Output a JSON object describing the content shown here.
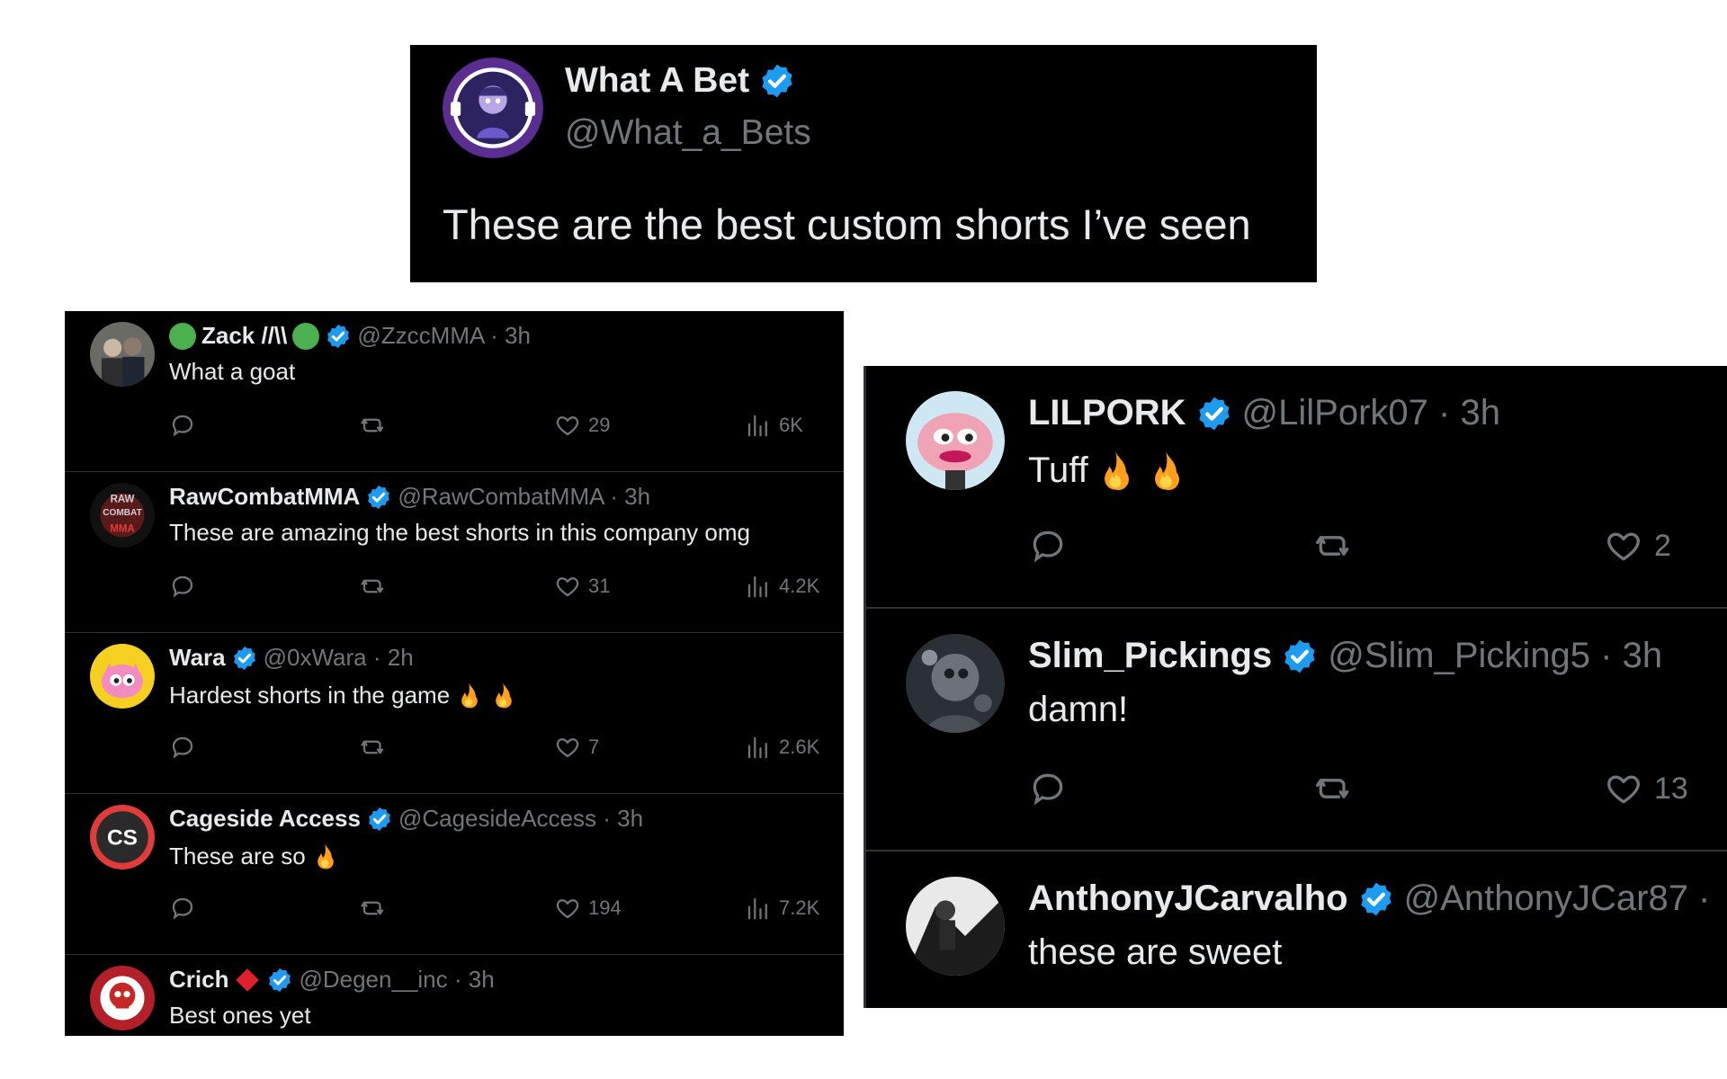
{
  "colors": {
    "verified": "#1d9bf0",
    "text": "#e7e9ea",
    "muted": "#71767b",
    "divider": "#2f3336",
    "background": "#000000"
  },
  "top_tweet": {
    "name": "What A Bet",
    "handle": "@What_a_Bets",
    "text": "These are the best custom shorts I’ve seen",
    "avatar_icon": "what-a-bet-avatar"
  },
  "left_replies": [
    {
      "name": "Zack //\\\\",
      "meta": "@ZzccMMA · 3h",
      "text": "What a goat",
      "likes": "29",
      "views": "6K"
    },
    {
      "name": "RawCombatMMA",
      "meta": "@RawCombatMMA · 3h",
      "text": "These are amazing the best shorts in this company omg",
      "likes": "31",
      "views": "4.2K",
      "avatar_text": "RAW COMBAT MMA"
    },
    {
      "name": "Wara",
      "meta": "@0xWara · 2h",
      "text": "Hardest shorts in the game",
      "likes": "7",
      "views": "2.6K"
    },
    {
      "name": "Cageside Access",
      "meta": "@CagesideAccess · 3h",
      "text": "These are so",
      "likes": "194",
      "views": "7.2K",
      "avatar_text": "CS"
    },
    {
      "name": "Crich",
      "meta": "@Degen__inc · 3h",
      "text": "Best ones yet"
    }
  ],
  "right_replies": [
    {
      "name": "LILPORK",
      "meta": "@LilPork07 · 3h",
      "text": "Tuff",
      "likes": "2"
    },
    {
      "name": "Slim_Pickings",
      "meta": "@Slim_Picking5 · 3h",
      "text": "damn!",
      "likes": "13"
    },
    {
      "name": "AnthonyJCarvalho",
      "meta": "@AnthonyJCar87 ·",
      "text": "these are sweet"
    }
  ]
}
